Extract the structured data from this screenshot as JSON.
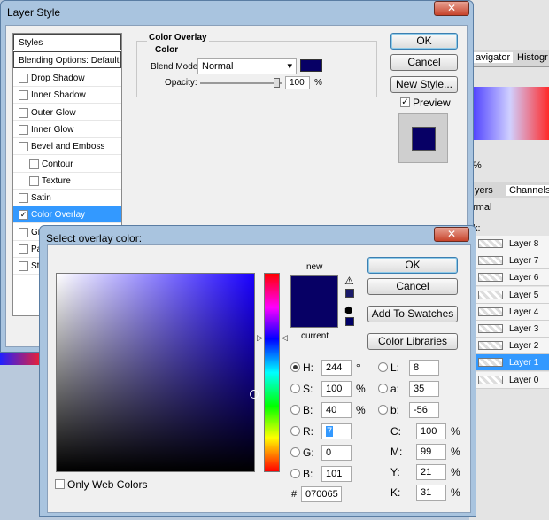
{
  "layer_style": {
    "title": "Layer Style",
    "styles_header": "Styles",
    "blending_options": "Blending Options: Default",
    "items": [
      {
        "label": "Drop Shadow",
        "checked": false,
        "sub": false
      },
      {
        "label": "Inner Shadow",
        "checked": false,
        "sub": false
      },
      {
        "label": "Outer Glow",
        "checked": false,
        "sub": false
      },
      {
        "label": "Inner Glow",
        "checked": false,
        "sub": false
      },
      {
        "label": "Bevel and Emboss",
        "checked": false,
        "sub": false
      },
      {
        "label": "Contour",
        "checked": false,
        "sub": true
      },
      {
        "label": "Texture",
        "checked": false,
        "sub": true
      },
      {
        "label": "Satin",
        "checked": false,
        "sub": false
      },
      {
        "label": "Color Overlay",
        "checked": true,
        "sub": false,
        "selected": true
      },
      {
        "label": "Gra",
        "checked": false,
        "sub": false
      },
      {
        "label": "Pat",
        "checked": false,
        "sub": false
      },
      {
        "label": "Stro",
        "checked": false,
        "sub": false
      }
    ],
    "section_title": "Color Overlay",
    "group_title": "Color",
    "blend_mode_label": "Blend Mode:",
    "blend_mode_value": "Normal",
    "opacity_label": "Opacity:",
    "opacity_value": "100",
    "opacity_unit": "%",
    "overlay_color": "#070065",
    "ok": "OK",
    "cancel": "Cancel",
    "new_style": "New Style...",
    "preview": "Preview",
    "preview_checked": true
  },
  "picker": {
    "title": "Select overlay color:",
    "new_label": "new",
    "current_label": "current",
    "ok": "OK",
    "cancel": "Cancel",
    "add_to_swatches": "Add To Swatches",
    "color_libraries": "Color Libraries",
    "only_web_colors": "Only Web Colors",
    "new_color": "#070065",
    "current_color": "#070065",
    "hsb": [
      {
        "label": "H:",
        "value": "244",
        "unit": "°",
        "on": true
      },
      {
        "label": "S:",
        "value": "100",
        "unit": "%",
        "on": false
      },
      {
        "label": "B:",
        "value": "40",
        "unit": "%",
        "on": false
      }
    ],
    "rgb": [
      {
        "label": "R:",
        "value": "7",
        "on": false
      },
      {
        "label": "G:",
        "value": "0",
        "on": false
      },
      {
        "label": "B:",
        "value": "101",
        "on": false
      }
    ],
    "lab": [
      {
        "label": "L:",
        "value": "8"
      },
      {
        "label": "a:",
        "value": "35"
      },
      {
        "label": "b:",
        "value": "-56"
      }
    ],
    "cmyk": [
      {
        "label": "C:",
        "value": "100",
        "unit": "%"
      },
      {
        "label": "M:",
        "value": "99",
        "unit": "%"
      },
      {
        "label": "Y:",
        "value": "21",
        "unit": "%"
      },
      {
        "label": "K:",
        "value": "31",
        "unit": "%"
      }
    ],
    "hex_label": "#",
    "hex_value": "070065"
  },
  "background": {
    "tab_navigator": "avigator",
    "tab_histogram": "Histogr",
    "tab_layers": "yers",
    "tab_channels": "Channels",
    "blend": "rmal",
    "lock": "k:",
    "zoom": "%",
    "layers": [
      "Layer 8",
      "Layer 7",
      "Layer 6",
      "Layer 5",
      "Layer 4",
      "Layer 3",
      "Layer 2",
      "Layer 1",
      "Layer 0"
    ],
    "selected_layer": "Layer 1"
  }
}
